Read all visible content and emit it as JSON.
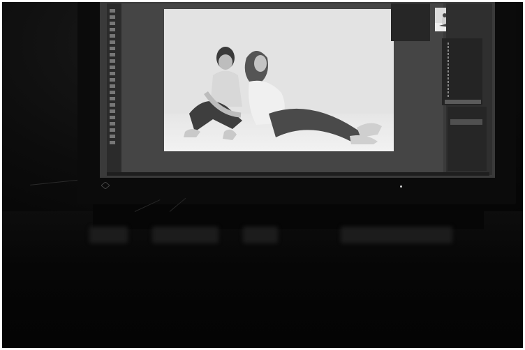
{
  "scene": {
    "description_kind": "photograph",
    "colors": {
      "screen": "#3a3a3a",
      "photo_bg": "#e3e3e3",
      "frame": "#ffffff",
      "background": "#070707"
    }
  },
  "editor": {
    "tools_icon": "tool-icon",
    "history_items": [
      "",
      "",
      "",
      "",
      "",
      "",
      "",
      "",
      "",
      "",
      "",
      "",
      "",
      "",
      "",
      ""
    ],
    "nav_label": "",
    "status_text": ""
  },
  "monitor": {
    "brand_icon": "brand-logo-icon",
    "power_led_icon": "power-led-icon"
  }
}
